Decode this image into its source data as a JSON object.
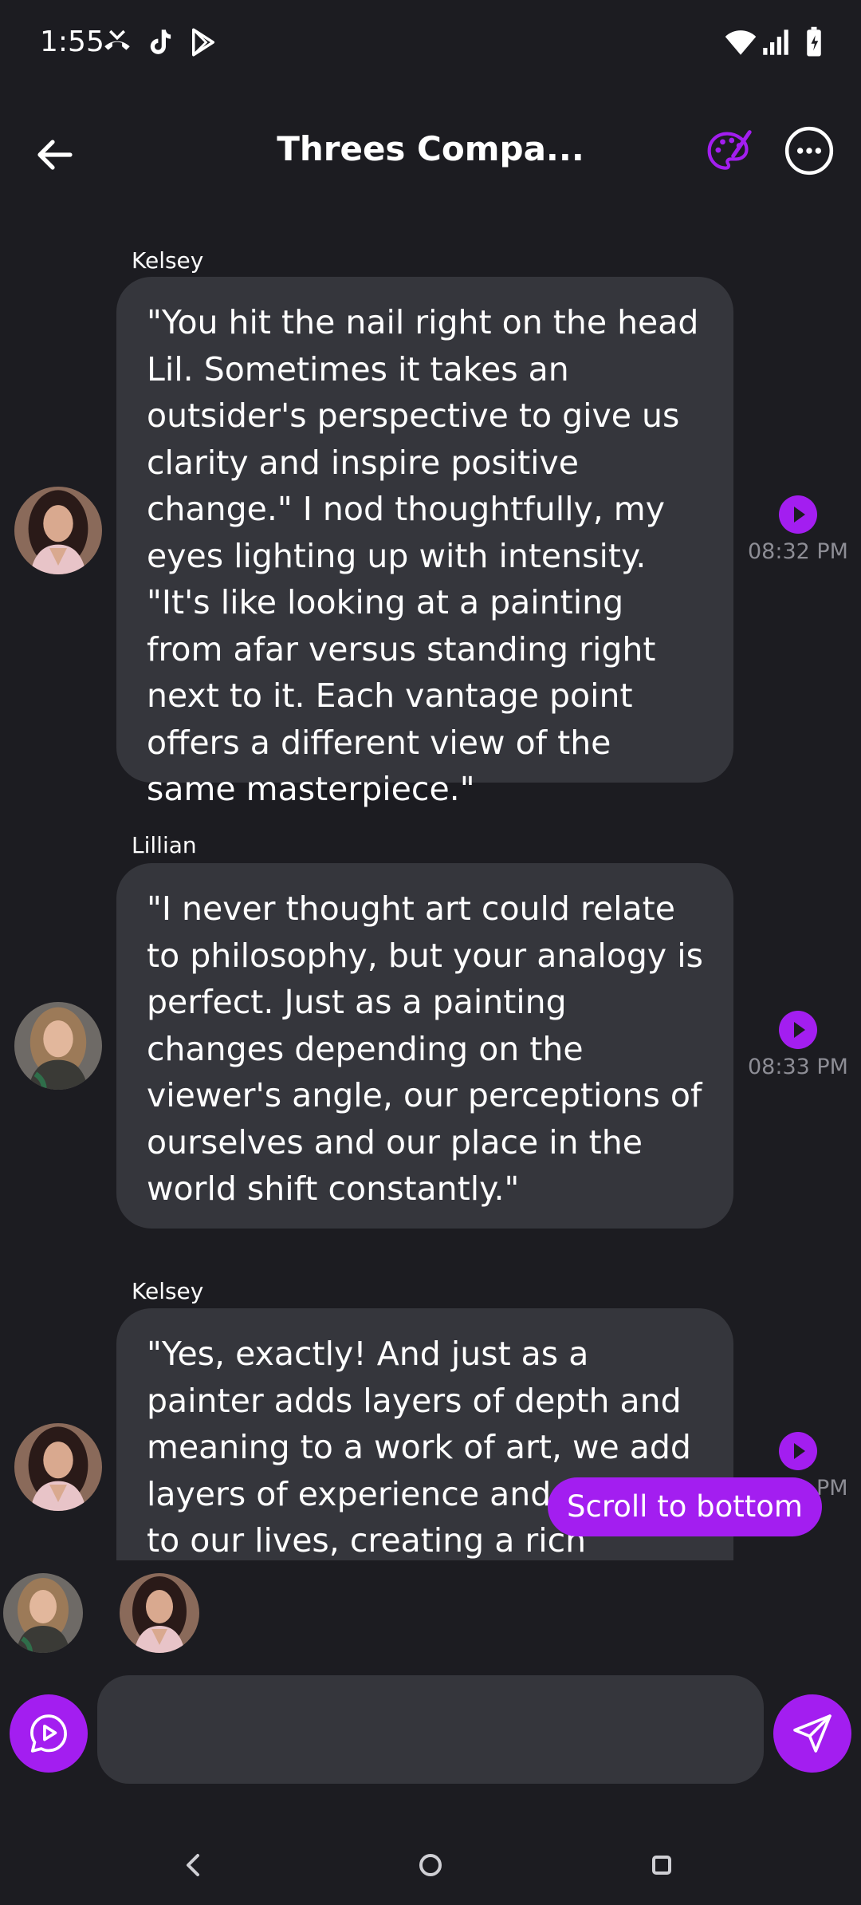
{
  "status_bar": {
    "time": "1:55",
    "left_icons": [
      "missed-call-icon",
      "tiktok-icon",
      "play-store-icon"
    ],
    "right_icons": [
      "wifi-icon",
      "signal-icon",
      "battery-charging-icon"
    ]
  },
  "header": {
    "title": "Threes Compa...",
    "accent_color": "#a31ef0"
  },
  "messages": [
    {
      "sender": "Kelsey",
      "text": "\"You hit the nail right on the head Lil. Sometimes it takes an outsider's perspective to give us clarity and inspire positive change.\" I nod thoughtfully, my eyes lighting up with intensity. \"It's like looking at a painting from afar versus standing right next to it. Each vantage point offers a different view of the same masterpiece.\"",
      "time": "08:32 PM"
    },
    {
      "sender": "Lillian",
      "text": "\"I never thought art could relate to philosophy, but your analogy is perfect. Just as a painting changes depending on the viewer's angle, our perceptions of ourselves and our place in the world shift constantly.\"",
      "time": "08:33 PM"
    },
    {
      "sender": "Kelsey",
      "text": "\"Yes, exactly! And just as a painter adds layers of depth and meaning to a work of art, we add layers of experience and emotion to our lives, creating a rich tapestry of",
      "time": "PM"
    }
  ],
  "scroll_to_bottom_label": "Scroll to bottom",
  "composer": {
    "value": "",
    "placeholder": ""
  },
  "colors": {
    "background": "#1c1c21",
    "bubble": "#35363c",
    "accent": "#a31ef0",
    "timestamp": "#8d8d95"
  }
}
